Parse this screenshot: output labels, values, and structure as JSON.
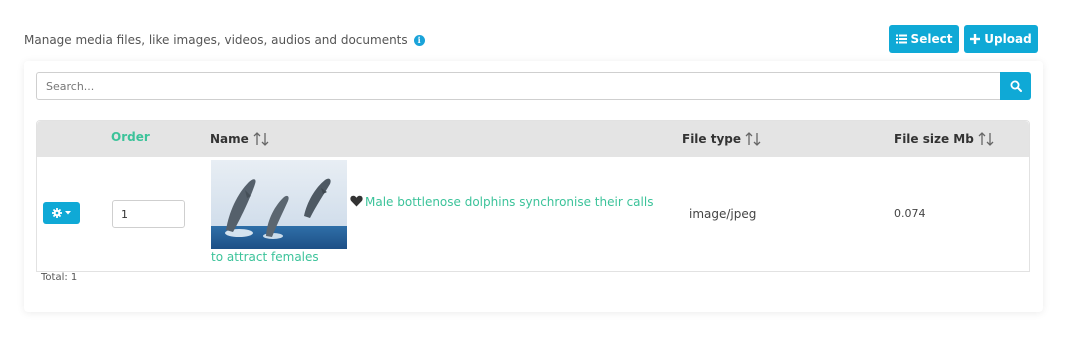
{
  "header": {
    "description": "Manage media files, like images, videos, audios and documents",
    "select_label": "Select",
    "upload_label": "Upload"
  },
  "search": {
    "placeholder": "Search..."
  },
  "table": {
    "columns": {
      "order": "Order",
      "name": "Name",
      "file_type": "File type",
      "file_size": "File size Mb"
    },
    "rows": [
      {
        "order": "1",
        "name_line1": "Male bottlenose dolphins synchronise their calls",
        "name_line2": "to attract females",
        "file_type": "image/jpeg",
        "file_size": "0.074"
      }
    ]
  },
  "footer": {
    "total": "Total: 1"
  },
  "colors": {
    "accent": "#0fa9d6",
    "link_green": "#3cc39a",
    "header_bg": "#e4e4e4"
  },
  "icons": [
    "info-icon",
    "list-icon",
    "plus-icon",
    "search-icon",
    "sort-icon",
    "gear-icon",
    "caret-down-icon",
    "heart-icon"
  ]
}
